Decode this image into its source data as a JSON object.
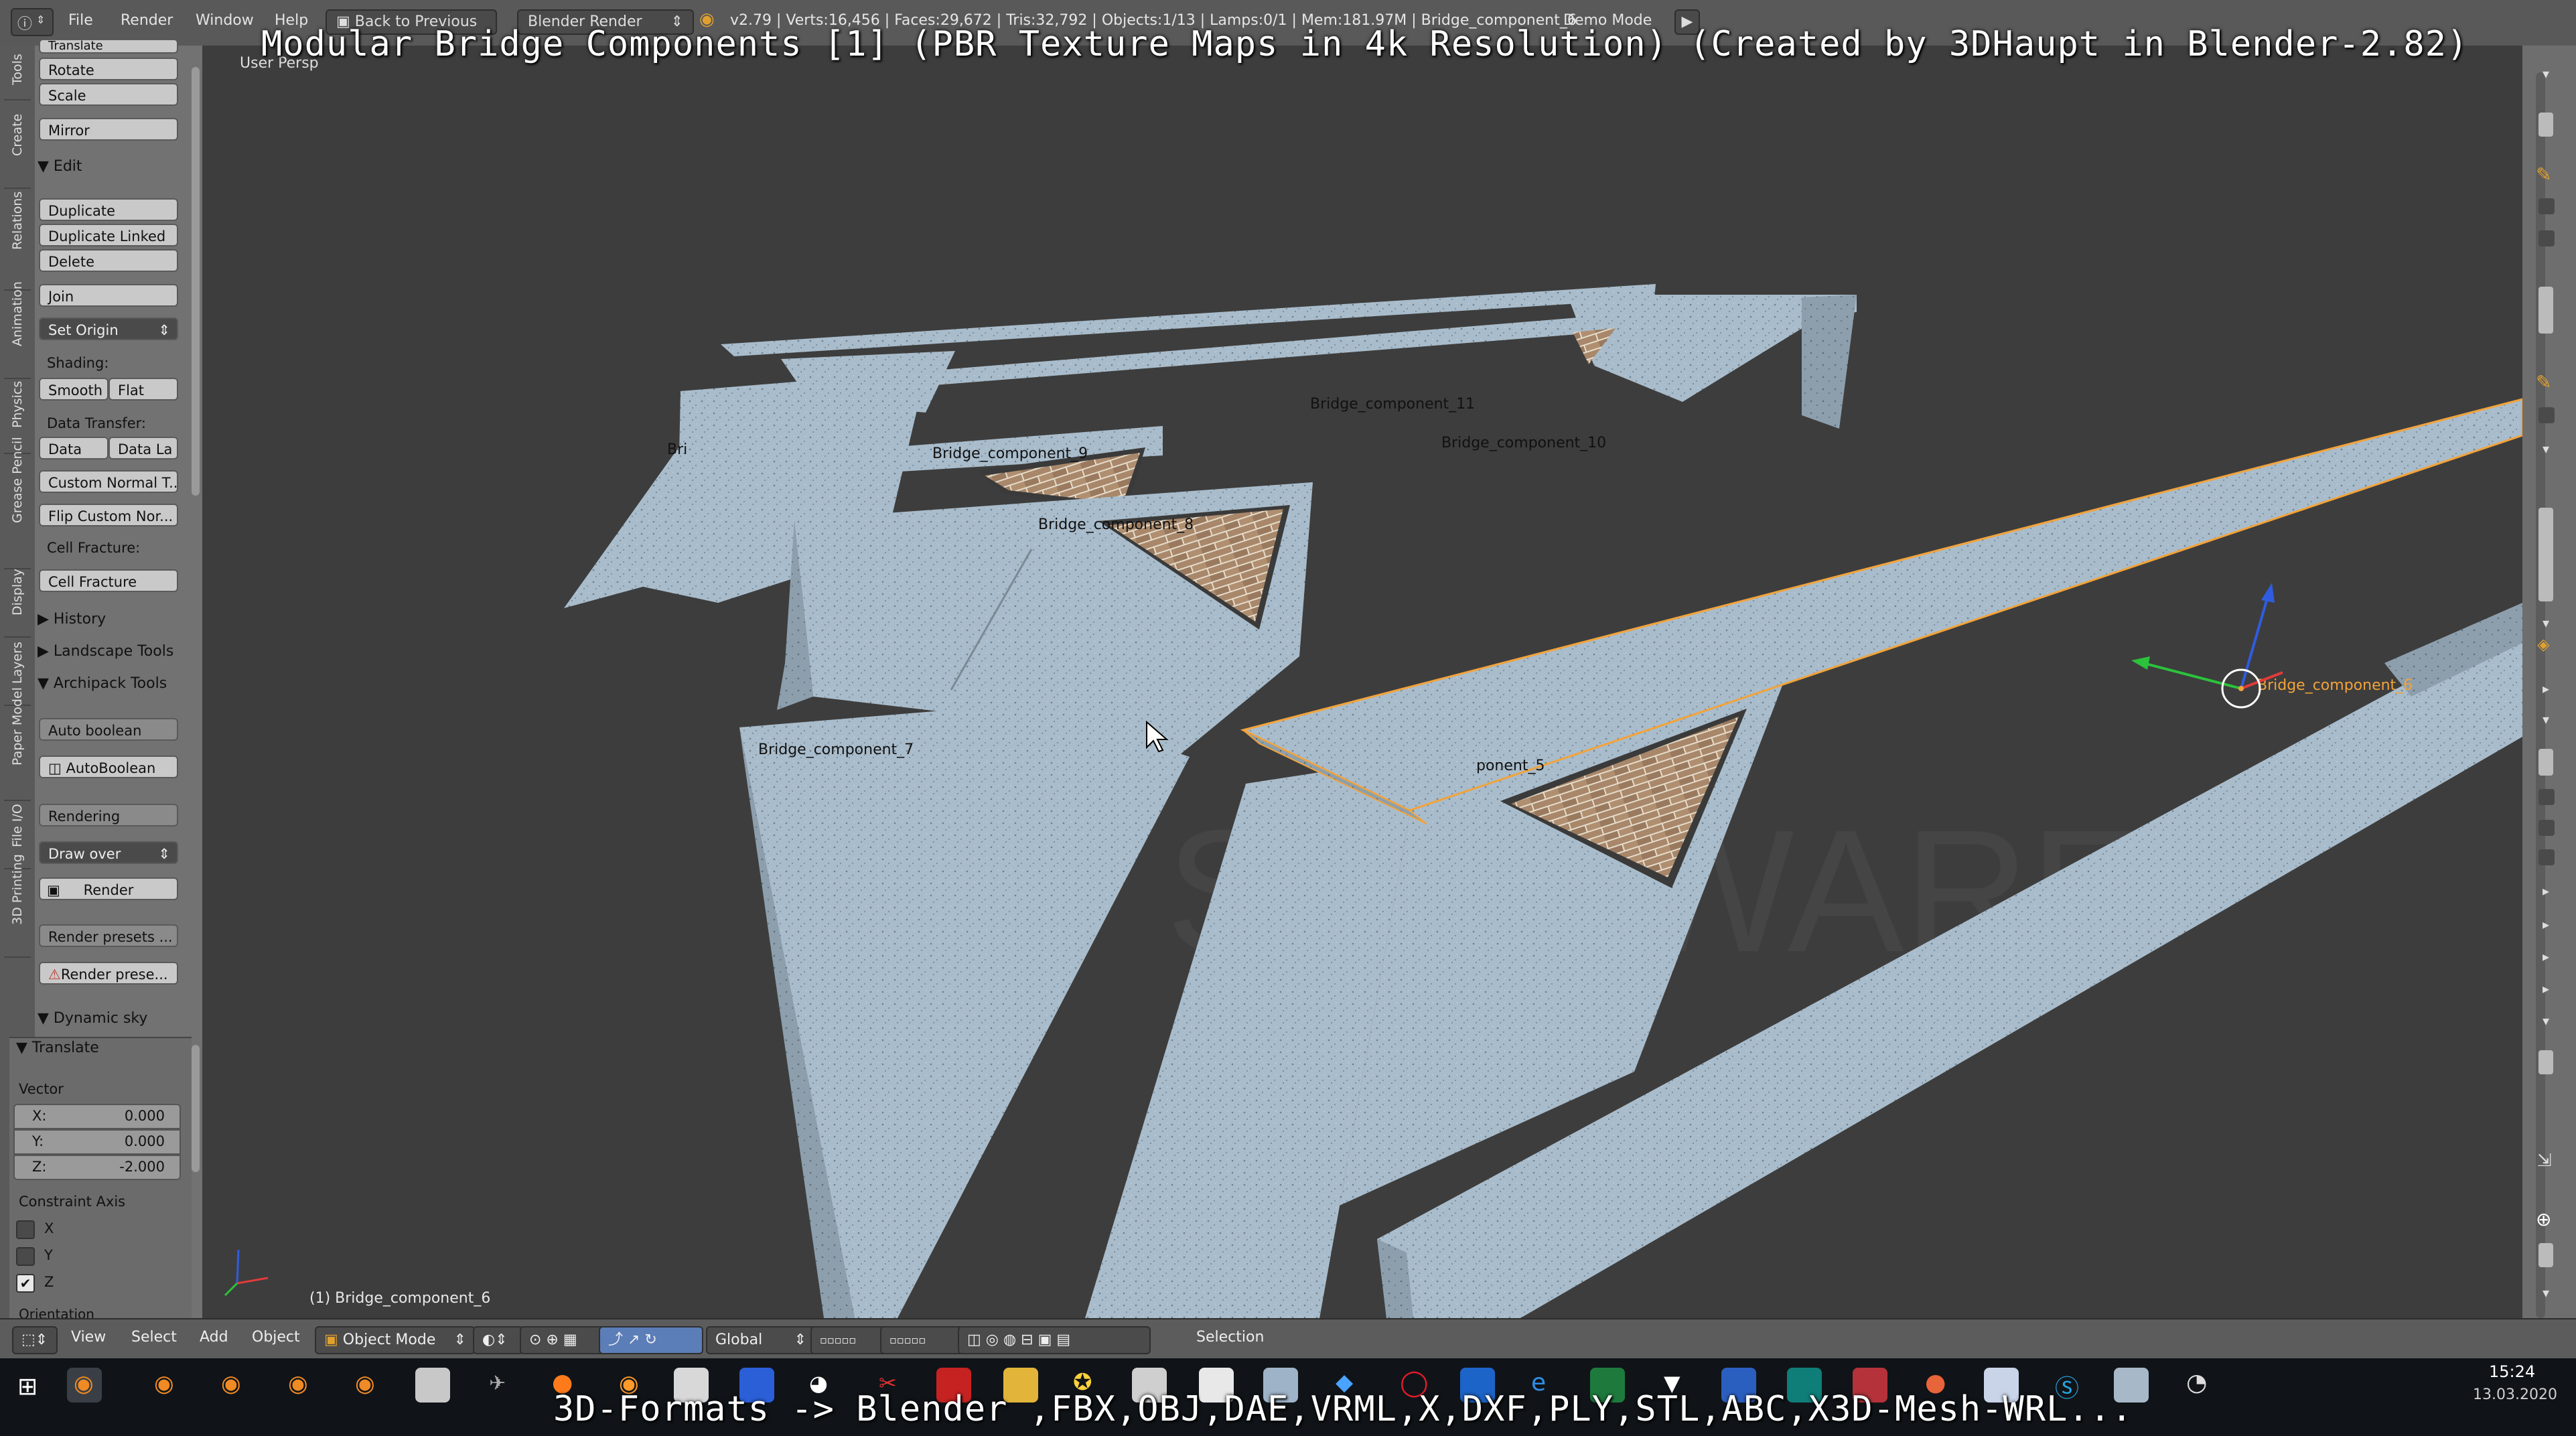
{
  "overlay": {
    "title": "Modular Bridge Components [1] (PBR Texture Maps in 4k Resolution) (Created by 3DHaupt in Blender-2.82)",
    "subtitle": "3D-Formats -> Blender ,FBX,OBJ,DAE,VRML,X,DXF,PLY,STL,ABC,X3D-Mesh-WRL..."
  },
  "topbar": {
    "menus": [
      "File",
      "Render",
      "Window",
      "Help"
    ],
    "back_button": "Back to Previous",
    "render_engine": "Blender Render",
    "stats": "v2.79 | Verts:16,456 | Faces:29,672 | Tris:32,792 | Objects:1/13 | Lamps:0/1 | Mem:181.97M | Bridge_component_6",
    "screen_name": "Demo Mode"
  },
  "shelf_tabs": [
    "Tools",
    "Create",
    "Relations",
    "Animation",
    "Physics",
    "Grease Pencil",
    "Display",
    "Layers",
    "Paper Model",
    "File I/O",
    "3D Printing"
  ],
  "tools": {
    "transform_buttons": [
      "Translate",
      "Rotate",
      "Scale",
      "Mirror"
    ],
    "edit_header": "Edit",
    "edit_buttons": [
      "Duplicate",
      "Duplicate Linked",
      "Delete",
      "Join"
    ],
    "set_origin": "Set Origin",
    "shading_label": "Shading:",
    "smooth": "Smooth",
    "flat": "Flat",
    "data_transfer_label": "Data Transfer:",
    "data": "Data",
    "data_la": "Data La",
    "custom_normal": "Custom Normal T...",
    "flip_custom": "Flip Custom Nor...",
    "cell_fracture_label": "Cell Fracture:",
    "cell_fracture": "Cell Fracture",
    "history": "History",
    "landscape": "Landscape Tools",
    "archipack": "Archipack Tools",
    "auto_boolean_label": "Auto boolean",
    "auto_boolean": "AutoBoolean",
    "rendering_label": "Rendering",
    "draw_over": "Draw over",
    "render": "Render",
    "render_presets_label": "Render presets ...",
    "render_presets": "Render prese...",
    "dynamic_sky": "Dynamic sky"
  },
  "operator": {
    "header": "Translate",
    "vector_label": "Vector",
    "x": {
      "label": "X:",
      "value": "0.000"
    },
    "y": {
      "label": "Y:",
      "value": "0.000"
    },
    "z": {
      "label": "Z:",
      "value": "-2.000"
    },
    "constraint_label": "Constraint Axis",
    "cx": "X",
    "cy": "Y",
    "cz": "Z",
    "constraint_checked": {
      "x": false,
      "y": false,
      "z": true
    },
    "orientation_label": "Orientation"
  },
  "viewport": {
    "view_name": "User Persp",
    "selected_object": "(1) Bridge_component_6",
    "labels": {
      "c11": "Bridge_component_11",
      "c10": "Bridge_component_10",
      "c9": "Bridge_component_9",
      "c8": "Bridge_component_8",
      "c7": "Bridge_component_7",
      "c5": "ponent_5",
      "c6": "Bridge_component_6",
      "bri": "Bri"
    },
    "watermark": "SOFTWARE"
  },
  "view_header": {
    "menus": [
      "View",
      "Select",
      "Add",
      "Object"
    ],
    "mode": "Object Mode",
    "orientation": "Global",
    "layer_status": "Selection"
  },
  "taskbar": {
    "time": "15:24",
    "date": "13.03.2020"
  },
  "colors": {
    "concrete": "#a9bccb",
    "brick": "#a8876a",
    "selection": "#f2a33a",
    "viewport_bg": "#3d3d3d"
  }
}
